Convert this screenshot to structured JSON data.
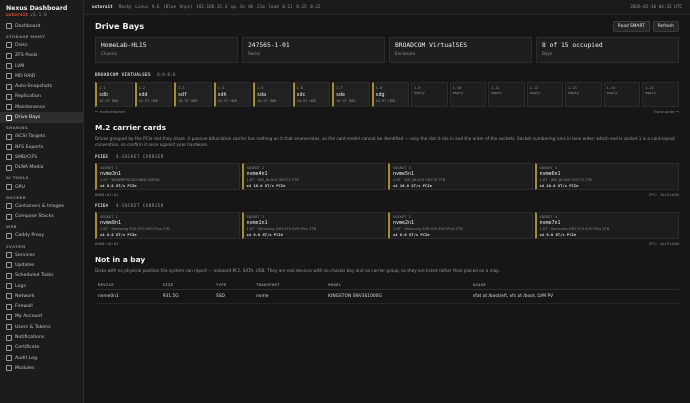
{
  "sidebar": {
    "title": "Nexus Dashboard",
    "host": "ustorsit",
    "version": "v3.1.0",
    "sections": [
      {
        "label": "",
        "items": [
          {
            "label": "Dashboard",
            "icon": "dashboard-icon"
          }
        ]
      },
      {
        "label": "STORAGE MGMT",
        "items": [
          {
            "label": "Disks",
            "icon": "disk-icon"
          },
          {
            "label": "ZFS Pools",
            "icon": "pool-icon"
          },
          {
            "label": "LVM",
            "icon": "layers-icon"
          },
          {
            "label": "MD RAID",
            "icon": "raid-icon"
          },
          {
            "label": "Auto-Snapshots",
            "icon": "camera-icon"
          },
          {
            "label": "Replication",
            "icon": "sync-icon"
          },
          {
            "label": "Maintenance",
            "icon": "wrench-icon"
          },
          {
            "label": "Drive Bays",
            "icon": "bays-icon",
            "active": true
          }
        ]
      },
      {
        "label": "SHARING",
        "items": [
          {
            "label": "iSCSI Targets",
            "icon": "target-icon"
          },
          {
            "label": "NFS Exports",
            "icon": "export-icon"
          },
          {
            "label": "SMB/CIFS",
            "icon": "folder-icon"
          },
          {
            "label": "DLNA Media",
            "icon": "media-icon"
          }
        ]
      },
      {
        "label": "AI TOOLS",
        "items": [
          {
            "label": "GPU",
            "icon": "gpu-icon"
          }
        ]
      },
      {
        "label": "DOCKER",
        "items": [
          {
            "label": "Containers & Images",
            "icon": "container-icon"
          },
          {
            "label": "Compose Stacks",
            "icon": "stack-icon"
          }
        ]
      },
      {
        "label": "WEB",
        "items": [
          {
            "label": "Caddy Proxy",
            "icon": "globe-icon"
          }
        ]
      },
      {
        "label": "SYSTEM",
        "items": [
          {
            "label": "Services",
            "icon": "services-icon"
          },
          {
            "label": "Updates",
            "icon": "update-icon"
          },
          {
            "label": "Scheduled Tasks",
            "icon": "clock-icon"
          },
          {
            "label": "Logs",
            "icon": "log-icon"
          },
          {
            "label": "Network",
            "icon": "network-icon"
          },
          {
            "label": "Firewall",
            "icon": "firewall-icon"
          },
          {
            "label": "My Account",
            "icon": "user-icon"
          },
          {
            "label": "Users & Tokens",
            "icon": "users-icon"
          },
          {
            "label": "Notifications",
            "icon": "bell-icon"
          },
          {
            "label": "Certificate",
            "icon": "certificate-icon"
          },
          {
            "label": "Audit Log",
            "icon": "audit-icon"
          },
          {
            "label": "Modules",
            "icon": "modules-icon"
          }
        ]
      }
    ]
  },
  "topbar": {
    "host": "ustorsit",
    "info": "Rocky Linux 9.6 (Blue Onyx)  192.168.35.4  up 3d 0h 21m  load 0.11 0.15 0.22",
    "time": "2026-05-16 04:33 UTC"
  },
  "page": {
    "title": "Drive Bays",
    "buttons": [
      "Read SMART",
      "Refresh"
    ]
  },
  "info_cards": [
    {
      "value": "HomeLab-HL15",
      "label": "Chassis"
    },
    {
      "value": "247565-1-01",
      "label": "Serial"
    },
    {
      "value": "BROADCOM VirtualSES",
      "label": "Enclosure"
    },
    {
      "value": "8 of 15 occupied",
      "label": "Bays"
    }
  ],
  "controller": {
    "name": "BROADCOM VIRTUALSES",
    "address": "0:0:0:0"
  },
  "bays": [
    {
      "num": "1-1",
      "dev": "sdb",
      "type": "10.9T HDD"
    },
    {
      "num": "1-2",
      "dev": "sdd",
      "type": "10.9T HDD"
    },
    {
      "num": "1-3",
      "dev": "sdf",
      "type": "10.9T HDD"
    },
    {
      "num": "1-4",
      "dev": "sdh",
      "type": "10.9T HDD"
    },
    {
      "num": "1-5",
      "dev": "sda",
      "type": "10.9T HDD"
    },
    {
      "num": "1-6",
      "dev": "sdc",
      "type": "10.9T HDD"
    },
    {
      "num": "1-7",
      "dev": "sde",
      "type": "10.9T HDD"
    },
    {
      "num": "1-8",
      "dev": "sdg",
      "type": "10.9T HDD"
    },
    {
      "num": "1-9",
      "dev": "",
      "type": "empty"
    },
    {
      "num": "1-10",
      "dev": "",
      "type": "empty"
    },
    {
      "num": "1-11",
      "dev": "",
      "type": "empty"
    },
    {
      "num": "1-12",
      "dev": "",
      "type": "empty"
    },
    {
      "num": "1-13",
      "dev": "",
      "type": "empty"
    },
    {
      "num": "1-14",
      "dev": "",
      "type": "empty"
    },
    {
      "num": "1-15",
      "dev": "",
      "type": "empty"
    }
  ],
  "bay_footer": {
    "left": "← motherboard",
    "right": "front plate →"
  },
  "m2": {
    "title": "M.2 carrier cards",
    "desc": "Drives grouped by the PCIe slot they share. A passive bifurcation carrier has nothing on it that enumerates, so the card model cannot be identified — only the slot it sits in and the order of the sockets. Socket numbering runs in lane order; which end is socket 1 is a card-layout convention, so confirm it once against your hardware.",
    "carriers": [
      {
        "slot": "PCIE5",
        "carrier": "4-SOCKET CARRIER",
        "sockets": [
          {
            "label": "SOCKET 1",
            "dev": "nvme3n1",
            "model": "1.9T · WDBMP9G0020BNC-WRSN",
            "link": "x4 8.0 GT/s PCIe"
          },
          {
            "label": "SOCKET 2",
            "dev": "nvme4n1",
            "model": "1.8T · WD_BLACK SN770 2TB",
            "link": "x4 16.0 GT/s PCIe"
          },
          {
            "label": "SOCKET 3",
            "dev": "nvme5n1",
            "model": "1.8T · WD_BLACK SN770 2TB",
            "link": "x4 16.0 GT/s PCIe"
          },
          {
            "label": "SOCKET 4",
            "dev": "nvme6n1",
            "model": "1.8T · WD_BLACK SN770 2TB",
            "link": "x4 16.0 GT/s PCIe"
          }
        ],
        "footer_left": "0000:01:01",
        "footer_right": "ZFS: ALLFLASH"
      },
      {
        "slot": "PCIE4",
        "carrier": "4-SOCKET CARRIER",
        "sockets": [
          {
            "label": "SOCKET 1",
            "dev": "nvme8n1",
            "model": "1.8T · Samsung SSD 970 EVO Plus 2TB",
            "link": "x4 8.0 GT/s PCIe"
          },
          {
            "label": "SOCKET 2",
            "dev": "nvme1n1",
            "model": "1.8T · Samsung SSD 970 EVO Plus 2TB",
            "link": "x4 8.0 GT/s PCIe"
          },
          {
            "label": "SOCKET 3",
            "dev": "nvme2n1",
            "model": "1.8T · Samsung SSD 970 EVO Plus 2TB",
            "link": "x4 8.0 GT/s PCIe"
          },
          {
            "label": "SOCKET 4",
            "dev": "nvme7n1",
            "model": "1.8T · Samsung SSD 970 EVO Plus 2TB",
            "link": "x4 8.0 GT/s PCIe"
          }
        ],
        "footer_left": "0000:c0:01",
        "footer_right": "ZFS: ALLFLASH"
      }
    ]
  },
  "not_in_bay": {
    "title": "Not in a bay",
    "desc": "Disks with no physical position the system can report — onboard M.2, SATA, USB. They are real devices with no chassis bay and no carrier group, so they are listed rather than placed on a map.",
    "columns": [
      "DEVICE",
      "SIZE",
      "TYPE",
      "TRANSPORT",
      "MODEL",
      "USAGE"
    ],
    "rows": [
      [
        "nvme0n1",
        "931.5G",
        "SSD",
        "nvme",
        "KINGSTON SNV3S1000G",
        "vfat at /boot/efi, xfs at /boot, LVM PV"
      ]
    ]
  }
}
